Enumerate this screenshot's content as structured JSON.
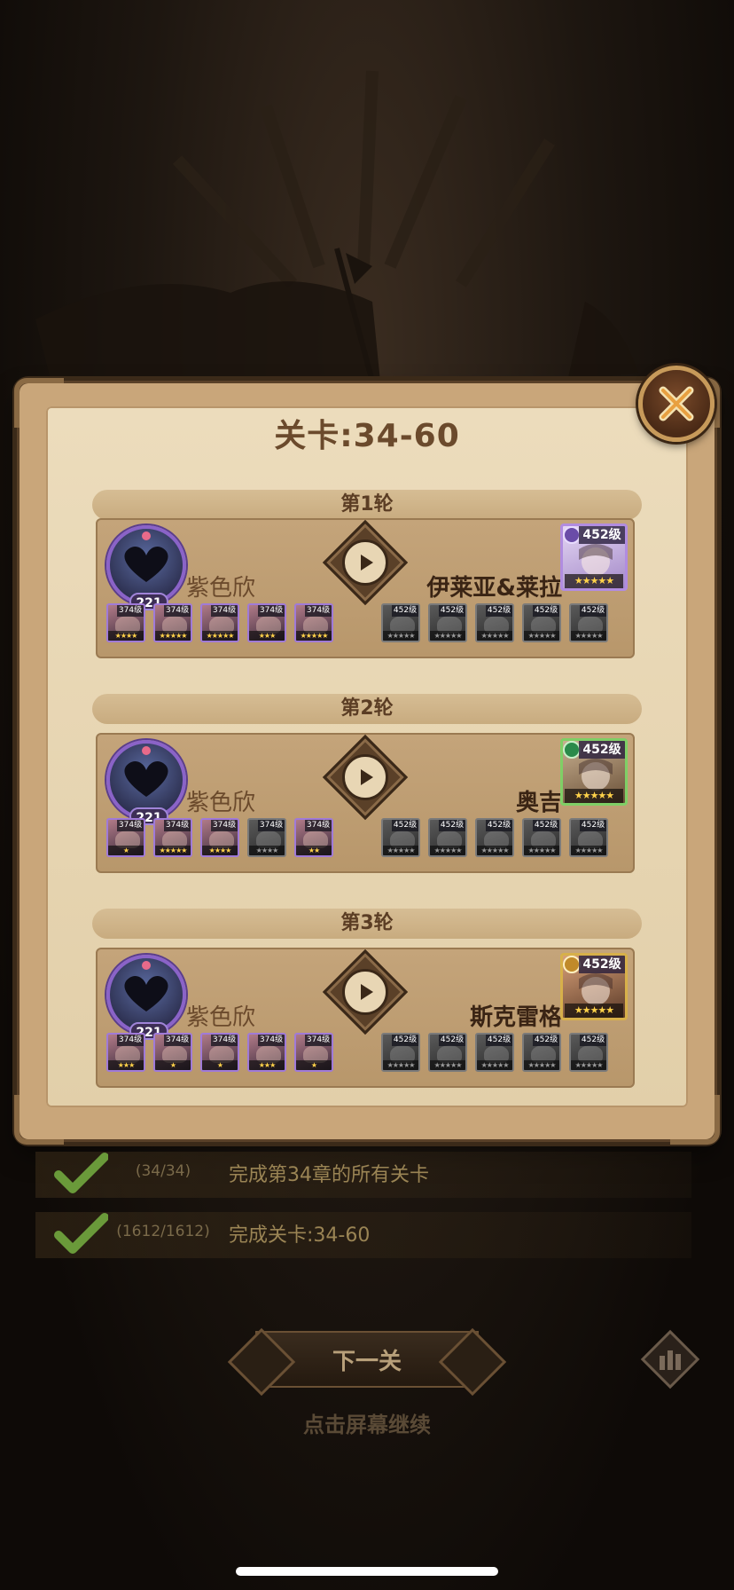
{
  "dialog": {
    "title": "关卡:34-60"
  },
  "rounds": [
    {
      "label": "第1轮",
      "player": {
        "name": "紫色欣",
        "level": "221"
      },
      "enemy": {
        "name": "伊莱亚&莱拉",
        "level": "452级",
        "stars": "★★★★★",
        "frame": "purple"
      },
      "player_heroes": [
        {
          "level": "374级",
          "stars": "★★★★"
        },
        {
          "level": "374级",
          "stars": "★★★★★"
        },
        {
          "level": "374级",
          "stars": "★★★★★"
        },
        {
          "level": "374级",
          "stars": "★★★"
        },
        {
          "level": "374级",
          "stars": "★★★★★"
        }
      ],
      "enemy_heroes": [
        {
          "level": "452级",
          "stars": "★★★★★"
        },
        {
          "level": "452级",
          "stars": "★★★★★"
        },
        {
          "level": "452级",
          "stars": "★★★★★"
        },
        {
          "level": "452级",
          "stars": "★★★★★"
        },
        {
          "level": "452级",
          "stars": "★★★★★"
        }
      ]
    },
    {
      "label": "第2轮",
      "player": {
        "name": "紫色欣",
        "level": "221"
      },
      "enemy": {
        "name": "奥吉",
        "level": "452级",
        "stars": "★★★★★",
        "frame": "green"
      },
      "player_heroes": [
        {
          "level": "374级",
          "stars": "★"
        },
        {
          "level": "374级",
          "stars": "★★★★★"
        },
        {
          "level": "374级",
          "stars": "★★★★"
        },
        {
          "level": "374级",
          "stars": "★★★★"
        },
        {
          "level": "374级",
          "stars": "★★"
        }
      ],
      "enemy_heroes": [
        {
          "level": "452级",
          "stars": "★★★★★"
        },
        {
          "level": "452级",
          "stars": "★★★★★"
        },
        {
          "level": "452级",
          "stars": "★★★★★"
        },
        {
          "level": "452级",
          "stars": "★★★★★"
        },
        {
          "level": "452级",
          "stars": "★★★★★"
        }
      ]
    },
    {
      "label": "第3轮",
      "player": {
        "name": "紫色欣",
        "level": "221"
      },
      "enemy": {
        "name": "斯克雷格",
        "level": "452级",
        "stars": "★★★★★",
        "frame": "gold"
      },
      "player_heroes": [
        {
          "level": "374级",
          "stars": "★★★"
        },
        {
          "level": "374级",
          "stars": "★"
        },
        {
          "level": "374级",
          "stars": "★"
        },
        {
          "level": "374级",
          "stars": "★★★"
        },
        {
          "level": "374级",
          "stars": "★"
        }
      ],
      "enemy_heroes": [
        {
          "level": "452级",
          "stars": "★★★★★"
        },
        {
          "level": "452级",
          "stars": "★★★★★"
        },
        {
          "level": "452级",
          "stars": "★★★★★"
        },
        {
          "level": "452级",
          "stars": "★★★★★"
        },
        {
          "level": "452级",
          "stars": "★★★★★"
        }
      ]
    }
  ],
  "achievements": [
    {
      "count": "(34/34)",
      "text": "完成第34章的所有关卡"
    },
    {
      "count": "(1612/1612)",
      "text": "完成关卡:34-60"
    }
  ],
  "footer": {
    "next_label": "下一关",
    "continue_hint": "点击屏幕继续"
  },
  "icons": {
    "close": "close-icon",
    "play": "play-icon",
    "check": "checkmark-icon",
    "stats": "stats-icon"
  },
  "colors": {
    "parchment": "#e2cfa9",
    "frame": "#8a6a44",
    "purple_frame": "#8a63c8",
    "green_check": "#6a9a3a"
  }
}
